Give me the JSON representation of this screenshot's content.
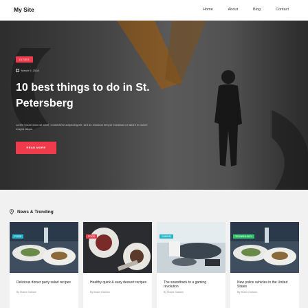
{
  "nav": {
    "brand": "My Site",
    "links": [
      "Home",
      "About",
      "Blog",
      "Contact"
    ]
  },
  "hero": {
    "category": "CITIES",
    "date": "March 9, 2018",
    "title": "10 best things to do in St. Petersberg",
    "excerpt": "Lorem ipsum dolor sit amet, consectetur adipiscing elit, sed do eiusmod tempor incididunt ut labore et dolore magna aliqua.",
    "button_label": "READ MORE",
    "accent_color": "#ef3b4c"
  },
  "trending": {
    "title": "News & Trending",
    "cards": [
      {
        "category": "FOOD",
        "title": "Delicious dinner party salad recipes",
        "author": "By Shane Graham"
      },
      {
        "category": "FOOD",
        "title": "Healthy quick & easy dessert recipes",
        "author": "By Shane Graham"
      },
      {
        "category": "GAMING",
        "title": "The soundtrack to a gaming revolution",
        "author": "By Shane Graham"
      },
      {
        "category": "TECHNOLOGY",
        "title": "New police vehicles in the United States",
        "author": "By Shane Graham"
      }
    ]
  }
}
